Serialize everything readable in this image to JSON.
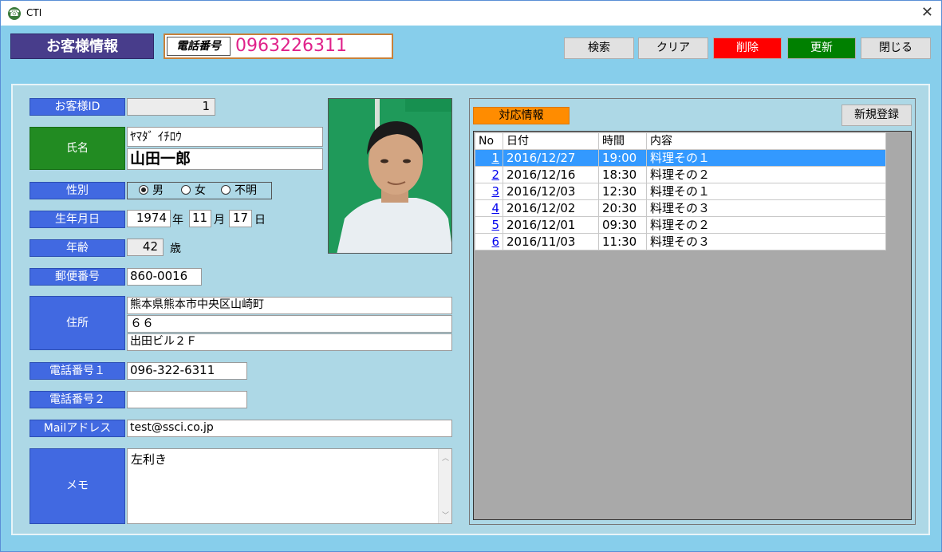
{
  "window": {
    "title": "CTI",
    "close_glyph": "✕",
    "icon": "phone-icon"
  },
  "header": {
    "title": "お客様情報",
    "phone_label": "電話番号",
    "phone_value": "0963226311"
  },
  "toolbar": {
    "search": "検索",
    "clear": "クリア",
    "delete": "削除",
    "update": "更新",
    "close": "閉じる"
  },
  "form": {
    "customer_id": {
      "label": "お客様ID",
      "value": "1"
    },
    "name": {
      "label": "氏名",
      "kana": "ﾔﾏﾀﾞ ｲﾁﾛｳ",
      "value": "山田一郎"
    },
    "gender": {
      "label": "性別",
      "options": [
        "男",
        "女",
        "不明"
      ],
      "selected": "男"
    },
    "birthdate": {
      "label": "生年月日",
      "year": "1974",
      "year_unit": "年",
      "month": "11",
      "month_unit": "月",
      "day": "17",
      "day_unit": "日"
    },
    "age": {
      "label": "年齢",
      "value": "42",
      "unit": "歳"
    },
    "postal": {
      "label": "郵便番号",
      "value": "860-0016"
    },
    "address": {
      "label": "住所",
      "line1": "熊本県熊本市中央区山崎町",
      "line2": "６６",
      "line3": "出田ビル２Ｆ"
    },
    "phone1": {
      "label": "電話番号１",
      "value": "096-322-6311"
    },
    "phone2": {
      "label": "電話番号２",
      "value": ""
    },
    "mail": {
      "label": "Mailアドレス",
      "value": "test@ssci.co.jp"
    },
    "memo": {
      "label": "メモ",
      "value": "左利き"
    }
  },
  "history": {
    "badge": "対応情報",
    "new_button": "新規登録",
    "columns": [
      "No",
      "日付",
      "時間",
      "内容"
    ],
    "selected_row": 0,
    "rows": [
      {
        "no": "1",
        "date": "2016/12/27",
        "time": "19:00",
        "content": "料理その１"
      },
      {
        "no": "2",
        "date": "2016/12/16",
        "time": "18:30",
        "content": "料理その２"
      },
      {
        "no": "3",
        "date": "2016/12/03",
        "time": "12:30",
        "content": "料理その１"
      },
      {
        "no": "4",
        "date": "2016/12/02",
        "time": "20:30",
        "content": "料理その３"
      },
      {
        "no": "5",
        "date": "2016/12/01",
        "time": "09:30",
        "content": "料理その２"
      },
      {
        "no": "6",
        "date": "2016/11/03",
        "time": "11:30",
        "content": "料理その３"
      }
    ]
  },
  "colors": {
    "background": "#87CEEB",
    "panel": "#ADD8E6",
    "label_blue": "#4169E1",
    "label_green": "#228B22",
    "title_purple": "#483D8B",
    "phone_pink": "#E0218A",
    "delete_red": "#FF0000",
    "update_green": "#008000",
    "badge_orange": "#FF8C00",
    "selection": "#3399FF"
  }
}
